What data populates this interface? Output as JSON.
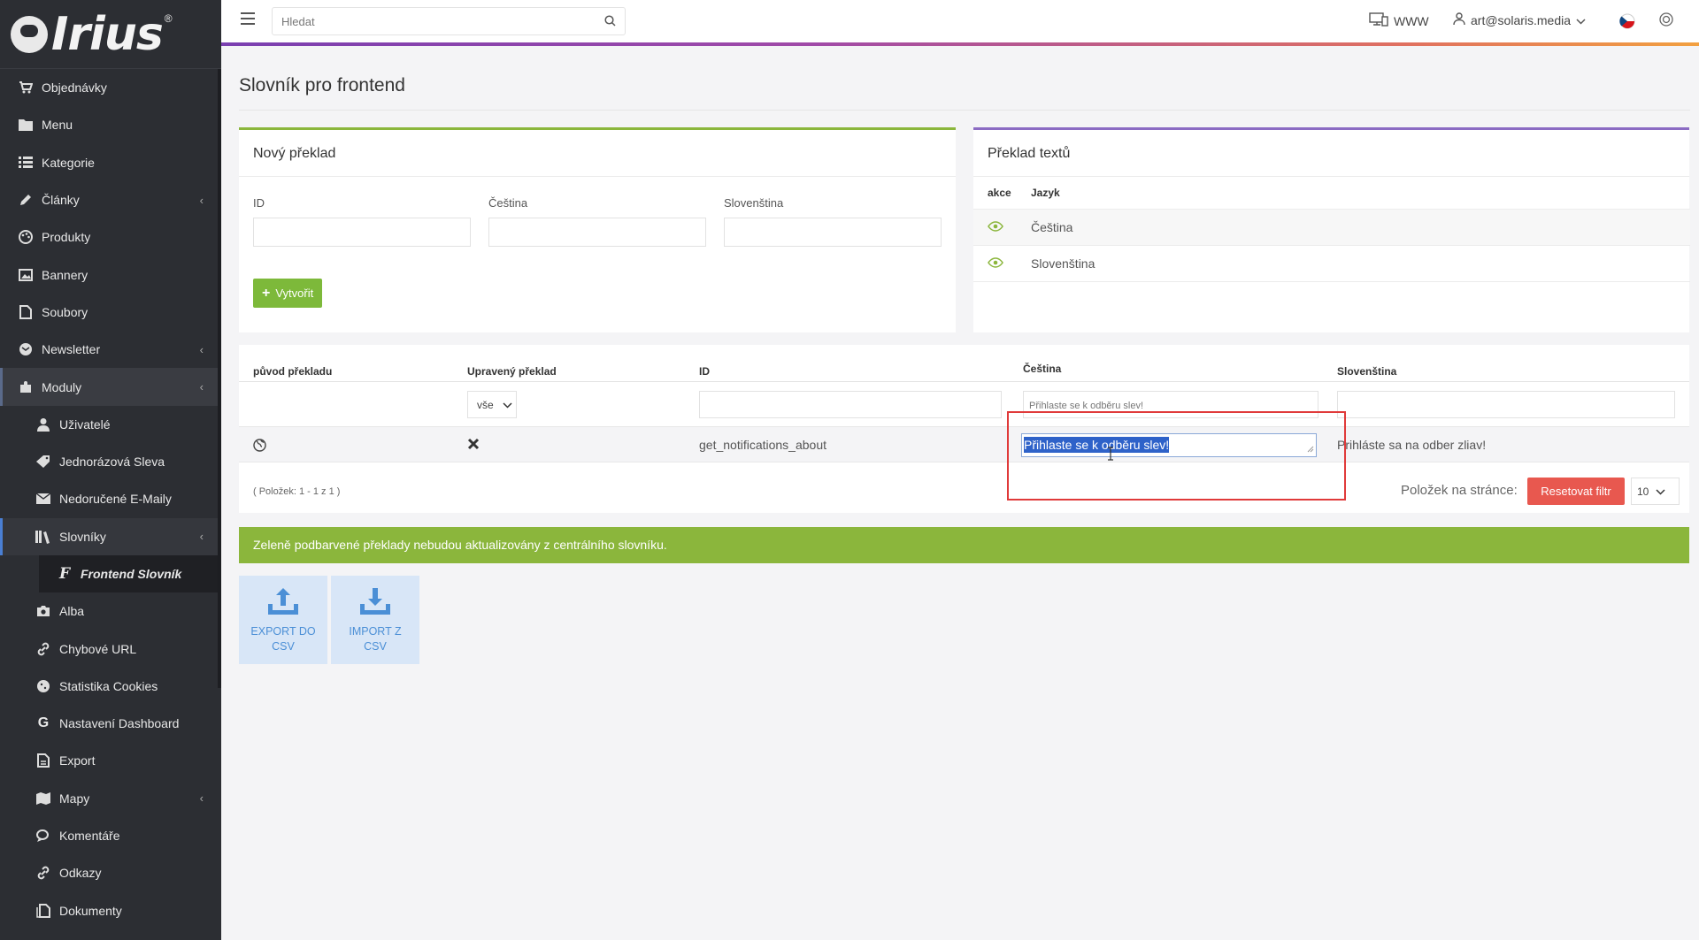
{
  "brand": {
    "name": "Irius",
    "reg": "®"
  },
  "sidebar": {
    "items": [
      {
        "label": "Objednávky",
        "icon": "cart-icon"
      },
      {
        "label": "Menu",
        "icon": "folder-icon"
      },
      {
        "label": "Kategorie",
        "icon": "list-icon"
      },
      {
        "label": "Články",
        "icon": "pencil-icon",
        "chevron": "‹"
      },
      {
        "label": "Produkty",
        "icon": "palette-icon"
      },
      {
        "label": "Bannery",
        "icon": "image-icon"
      },
      {
        "label": "Soubory",
        "icon": "file-icon"
      },
      {
        "label": "Newsletter",
        "icon": "mail-icon",
        "chevron": "‹"
      },
      {
        "label": "Moduly",
        "icon": "puzzle-icon",
        "chevron": "‹"
      },
      {
        "label": "Uživatelé",
        "icon": "user-icon"
      },
      {
        "label": "Jednorázová Sleva",
        "icon": "tag-icon"
      },
      {
        "label": "Nedoručené E-Maily",
        "icon": "envelope-icon"
      },
      {
        "label": "Slovníky",
        "icon": "books-icon",
        "chevron": "‹"
      },
      {
        "label": "Frontend Slovník",
        "icon": "font-icon"
      },
      {
        "label": "Alba",
        "icon": "camera-icon"
      },
      {
        "label": "Chybové URL",
        "icon": "link-icon"
      },
      {
        "label": "Statistika Cookies",
        "icon": "cookie-icon"
      },
      {
        "label": "Nastavení Dashboard",
        "icon": "google-icon"
      },
      {
        "label": "Export",
        "icon": "export-icon"
      },
      {
        "label": "Mapy",
        "icon": "map-icon",
        "chevron": "‹"
      },
      {
        "label": "Komentáře",
        "icon": "comments-icon"
      },
      {
        "label": "Odkazy",
        "icon": "link-icon"
      },
      {
        "label": "Dokumenty",
        "icon": "documents-icon"
      }
    ]
  },
  "topbar": {
    "search_placeholder": "Hledat",
    "www_label": "WWW",
    "user_label": "art@solaris.media"
  },
  "page": {
    "title": "Slovník pro frontend"
  },
  "new_translation": {
    "title": "Nový překlad",
    "fields": {
      "id": "ID",
      "cs": "Čeština",
      "sk": "Slovenština"
    },
    "create_label": "Vytvořit"
  },
  "text_translation": {
    "title": "Překlad textů",
    "col_action": "akce",
    "col_lang": "Jazyk",
    "languages": [
      "Čeština",
      "Slovenština"
    ]
  },
  "grid": {
    "headers": {
      "origin": "původ překladu",
      "edited": "Upravený překlad",
      "id": "ID",
      "cs": "Čeština",
      "sk": "Slovenština"
    },
    "filters": {
      "edited_select": "vše",
      "cs_value": "Přihlaste se k odběru slev!"
    },
    "row": {
      "id": "get_notifications_about",
      "cs_edit_value": "Přihlaste se k odběru slev!",
      "sk": "Prihláste sa na odber zliav!"
    },
    "count_label": "( Položek: 1 - 1 z 1 )",
    "per_page_label": "Položek na stránce:",
    "reset_label": "Resetovat filtr",
    "per_page_value": "10"
  },
  "info_bar": {
    "text": "Zeleně podbarvené překlady nebudou aktualizovány z centrálního slovníku."
  },
  "csv": {
    "export_label": "EXPORT DO CSV",
    "import_label": "IMPORT Z CSV"
  },
  "colors": {
    "green": "#8bb63c",
    "purple": "#8b6bc3",
    "red": "#e8584f",
    "sidebar": "#2c2e33"
  }
}
